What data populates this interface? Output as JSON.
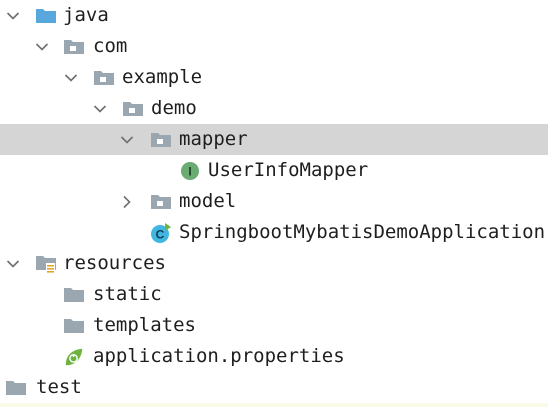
{
  "tree": {
    "java": "java",
    "com": "com",
    "example": "example",
    "demo": "demo",
    "mapper": "mapper",
    "user_info_mapper": "UserInfoMapper",
    "model": "model",
    "app_class": "SpringbootMybatisDemoApplication",
    "resources": "resources",
    "static": "static",
    "templates": "templates",
    "application_properties": "application.properties",
    "test": "test"
  },
  "icons": {
    "folder_gray": "#9aa7b0",
    "folder_blue": "#59a8dd",
    "chevron": "#6e6e6e",
    "interface_badge": "#6aab73",
    "class_badge": "#40b6e0",
    "spring_green": "#6db33f",
    "resources_lines": "#e4a72c"
  },
  "selection": {
    "selected_item": "mapper",
    "selected_bg": "#d5d5d5"
  }
}
